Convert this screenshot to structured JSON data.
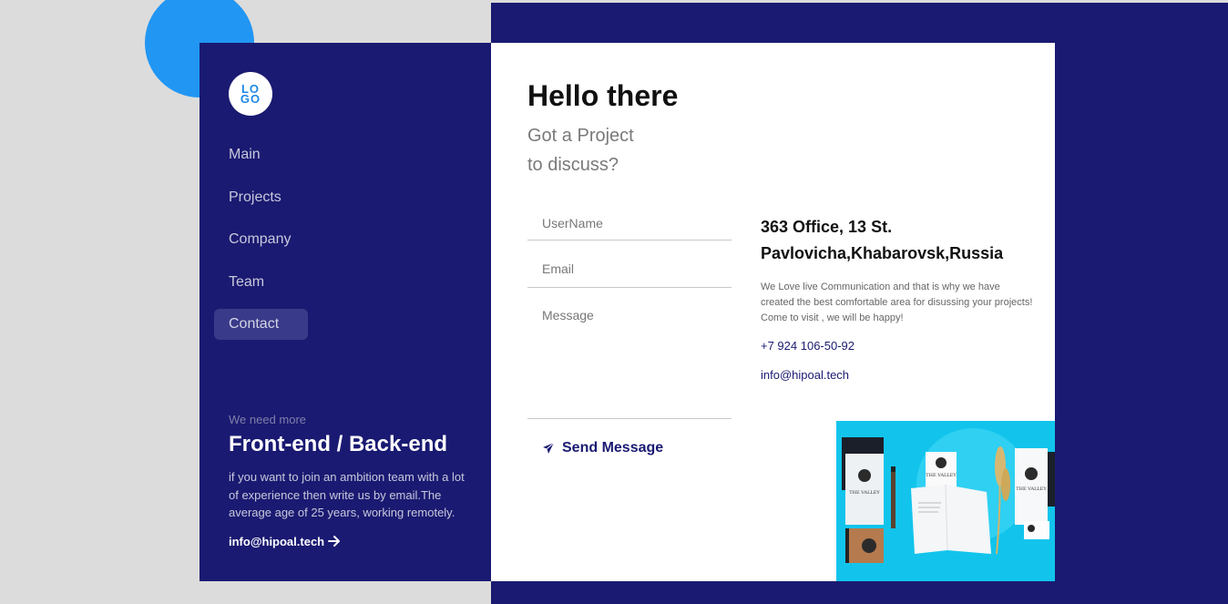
{
  "logo": {
    "line1": "LO",
    "line2": "GO"
  },
  "nav": {
    "items": [
      {
        "label": "Main"
      },
      {
        "label": "Projects"
      },
      {
        "label": "Company"
      },
      {
        "label": "Team"
      },
      {
        "label": "Contact",
        "active": true
      }
    ]
  },
  "sidebar_bottom": {
    "kicker": "We need more",
    "title": "Front-end / Back-end",
    "description": "if you want to join an ambition team with a lot of experience then write us by email.The average age of 25 years, working remotely.",
    "email_link": "info@hipoal.tech",
    "arrow_icon": "arrow-right-icon"
  },
  "main": {
    "title": "Hello there",
    "subtitle_line1": "Got a Project",
    "subtitle_line2": "to discuss?"
  },
  "form": {
    "username_placeholder": "UserName",
    "email_placeholder": "Email",
    "message_placeholder": "Message",
    "send_label": "Send Message",
    "send_icon": "paper-plane-icon"
  },
  "contact_info": {
    "address_line1": "363 Office, 13 St.",
    "address_line2": "Pavlovicha,Khabarovsk,Russia",
    "description": "We Love live Communication and that is why we have created the best comfortable area for disussing your projects! Come to visit , we will be happy!",
    "phone": "+7 924 106-50-92",
    "email": "info@hipoal.tech"
  },
  "photo": {
    "brand_text": "THE VALLEY"
  },
  "colors": {
    "navy": "#1a1a72",
    "accent_blue": "#2196f3",
    "photo_bg": "#12c4ec"
  }
}
